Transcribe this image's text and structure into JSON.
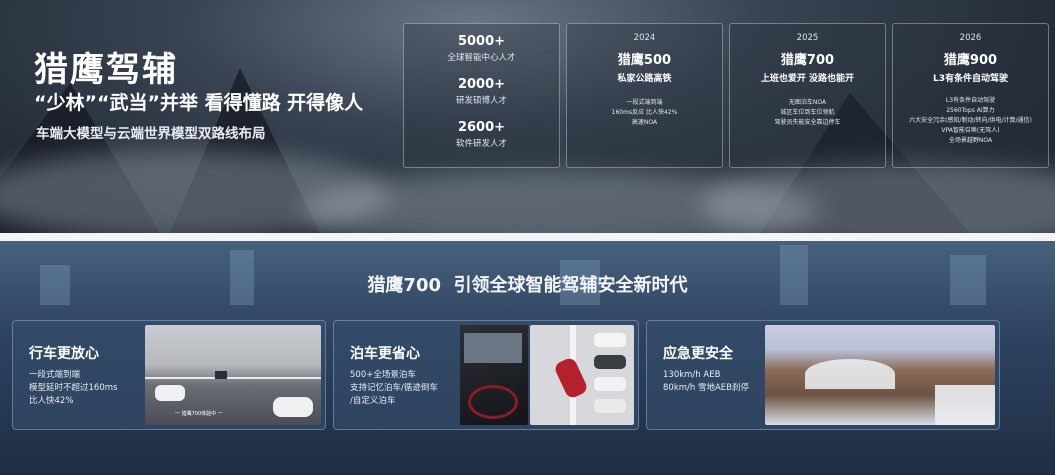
{
  "top": {
    "title": "猎鹰驾辅",
    "slogan": "“少林”“武当”并举 看得懂路 开得像人",
    "subtitle": "车端大模型与云端世界模型双路线布局",
    "stats": [
      {
        "value": "5000+",
        "label": "全球智能中心人才"
      },
      {
        "value": "2000+",
        "label": "研发硕博人才"
      },
      {
        "value": "2600+",
        "label": "软件研发人才"
      }
    ],
    "products": [
      {
        "year": "2024",
        "name": "猎鹰500",
        "tagline": "私家公路高铁",
        "features": [
          "一段式端到端",
          "160ms反应 比人快42%",
          "高速NOA"
        ]
      },
      {
        "year": "2025",
        "name": "猎鹰700",
        "tagline": "上班也爱开 没路也能开",
        "features": [
          "无图泊车NOA",
          "城区车位到车位领航",
          "驾驶员失能安全靠边停车"
        ]
      },
      {
        "year": "2026",
        "name": "猎鹰900",
        "tagline": "L3有条件自动驾驶",
        "features": [
          "L3有条件自动驾驶",
          "2560Tops AI算力",
          "六大安全冗余(感知/制动/转向/供电/计算/通信)",
          "VPA智能召唤(无驾人)",
          "全场景越野NOA"
        ]
      }
    ]
  },
  "bottom": {
    "headline_accent": "猎鹰700",
    "headline": "引领全球智能驾辅安全新时代",
    "cards": [
      {
        "title": "行车更放心",
        "lines": [
          "一段式端到端",
          "模型延时不超过160ms",
          "比人快42%"
        ],
        "image_caption": "一 猎鹰700体验中 一"
      },
      {
        "title": "泊车更省心",
        "lines": [
          "500+全场景泊车",
          "支持记忆泊车/循迹倒车",
          "/自定义泊车"
        ]
      },
      {
        "title": "应急更安全",
        "lines": [
          "130km/h AEB",
          "80km/h 雪地AEB刹停"
        ]
      }
    ]
  }
}
